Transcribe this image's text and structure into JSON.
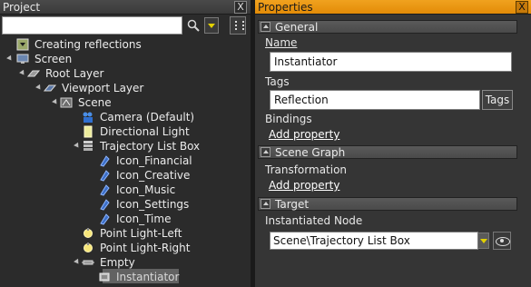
{
  "project": {
    "title": "Project",
    "close_label": "X",
    "search": {
      "value": "",
      "placeholder": ""
    },
    "tree": [
      {
        "label": "Creating reflections",
        "icon": "project-icon"
      },
      {
        "label": "Screen",
        "icon": "screen-icon"
      },
      {
        "label": "Root Layer",
        "icon": "layer-icon"
      },
      {
        "label": "Viewport Layer",
        "icon": "viewport-layer-icon"
      },
      {
        "label": "Scene",
        "icon": "scene-icon"
      },
      {
        "label": "Camera (Default)",
        "icon": "camera-icon"
      },
      {
        "label": "Directional Light",
        "icon": "directional-light-icon"
      },
      {
        "label": "Trajectory List Box",
        "icon": "list-box-icon"
      },
      {
        "label": "Icon_Financial",
        "icon": "model-icon"
      },
      {
        "label": "Icon_Creative",
        "icon": "model-icon"
      },
      {
        "label": "Icon_Music",
        "icon": "model-icon"
      },
      {
        "label": "Icon_Settings",
        "icon": "model-icon"
      },
      {
        "label": "Icon_Time",
        "icon": "model-icon"
      },
      {
        "label": "Point Light-Left",
        "icon": "point-light-icon"
      },
      {
        "label": "Point Light-Right",
        "icon": "point-light-icon"
      },
      {
        "label": "Empty",
        "icon": "empty-node-icon"
      },
      {
        "label": "Instantiator",
        "icon": "instantiator-icon",
        "selected": true
      }
    ]
  },
  "properties": {
    "title": "Properties",
    "close_label": "X",
    "general": {
      "title": "General",
      "name_label": "Name",
      "name_value": "Instantiator",
      "tags_label": "Tags",
      "tags_value": "Reflection",
      "tags_button": "Tags",
      "bindings_label": "Bindings",
      "add_property": "Add property"
    },
    "scene_graph": {
      "title": "Scene Graph",
      "transformation_label": "Transformation",
      "add_property": "Add property"
    },
    "target": {
      "title": "Target",
      "instantiated_node_label": "Instantiated Node",
      "instantiated_node_value": "Scene\\Trajectory List Box"
    }
  },
  "colors": {
    "properties_header": "#e9950f",
    "selection": "#c9c9c9",
    "dropdown_arrow": "#e2d000"
  }
}
